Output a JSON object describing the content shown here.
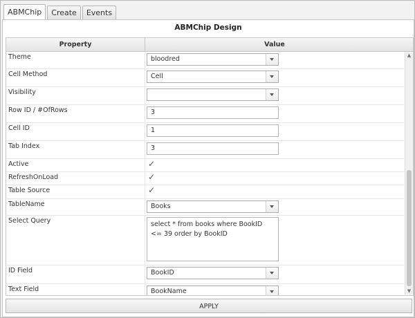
{
  "tabs": [
    {
      "label": "ABMChip"
    },
    {
      "label": "Create"
    },
    {
      "label": "Events"
    }
  ],
  "panel": {
    "title": "ABMChip Design",
    "headers": {
      "property": "Property",
      "value": "Value"
    }
  },
  "rows": {
    "theme": {
      "label": "Theme",
      "value": "bloodred"
    },
    "cell_method": {
      "label": "Cell Method",
      "value": "Cell"
    },
    "visibility": {
      "label": "Visibility",
      "value": ""
    },
    "row_id": {
      "label": "Row ID / #OfRows",
      "value": "3"
    },
    "cell_id": {
      "label": "Cell ID",
      "value": "1"
    },
    "tab_index": {
      "label": "Tab Index",
      "value": "3"
    },
    "active": {
      "label": "Active",
      "checked": true
    },
    "refresh_on_load": {
      "label": "RefreshOnLoad",
      "checked": true
    },
    "table_source": {
      "label": "Table Source",
      "checked": true
    },
    "table_name": {
      "label": "TableName",
      "value": "Books"
    },
    "select_query": {
      "label": "Select Query",
      "value": "select * from books where BookID <= 39 order by BookID"
    },
    "id_field": {
      "label": "ID Field",
      "value": "BookID"
    },
    "text_field": {
      "label": "Text Field",
      "value": "BookName"
    }
  },
  "apply_label": "APPLY",
  "check_glyph": "✓"
}
